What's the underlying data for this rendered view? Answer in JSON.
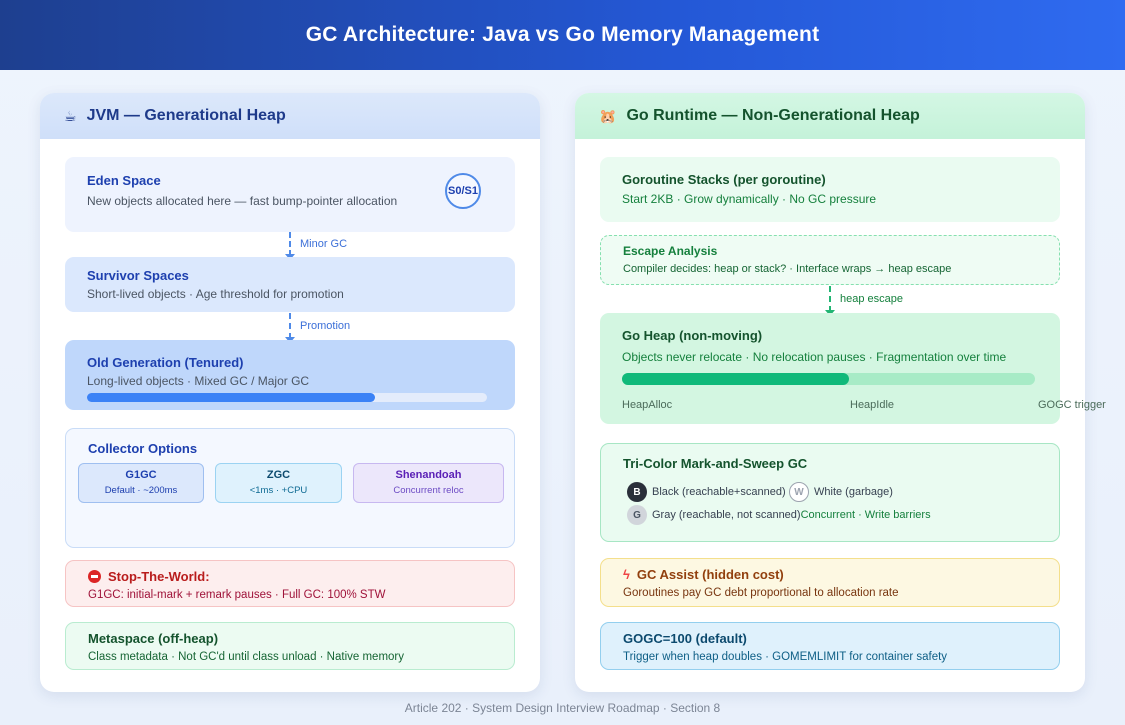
{
  "header": {
    "title": "GC Architecture: Java vs Go Memory Management"
  },
  "jvm": {
    "icon": "☕",
    "title": "JVM — Generational Heap",
    "eden": {
      "title": "Eden Space",
      "desc": "New objects allocated here — fast bump-pointer allocation",
      "badge": "S0/S1"
    },
    "arrow_minor": "Minor GC",
    "survivor": {
      "title": "Survivor Spaces",
      "desc": "Short-lived objects · Age threshold for promotion"
    },
    "arrow_promotion": "Promotion",
    "old_gen": {
      "title": "Old Generation (Tenured)",
      "desc": "Long-lived objects · Mixed GC / Major GC",
      "fill_fraction": 0.72
    },
    "collectors": {
      "title": "Collector Options",
      "items": [
        {
          "name": "G1GC",
          "desc": "Default · ~200ms"
        },
        {
          "name": "ZGC",
          "desc": "<1ms · +CPU"
        },
        {
          "name": "Shenandoah",
          "desc": "Concurrent reloc"
        }
      ]
    },
    "stw": {
      "title": "Stop-The-World:",
      "desc": "G1GC: initial-mark + remark pauses · Full GC: 100% STW"
    },
    "metaspace": {
      "title": "Metaspace (off-heap)",
      "desc": "Class metadata · Not GC'd until class unload · Native memory"
    }
  },
  "go": {
    "icon": "🐹",
    "title": "Go Runtime — Non-Generational Heap",
    "stacks": {
      "title": "Goroutine Stacks (per goroutine)",
      "desc": "Start 2KB · Grow dynamically · No GC pressure"
    },
    "escape": {
      "title": "Escape Analysis",
      "desc": "Compiler decides: heap or stack? · Interface wraps → heap escape"
    },
    "arrow_escape": "heap escape",
    "heap": {
      "title": "Go Heap (non-moving)",
      "desc": "Objects never relocate · No relocation pauses · Fragmentation over time",
      "fill_fraction": 0.55,
      "labels": [
        "HeapAlloc",
        "HeapIdle",
        "GOGC trigger"
      ]
    },
    "tricolor": {
      "title": "Tri-Color Mark-and-Sweep GC",
      "black": {
        "glyph": "B",
        "label": "Black (reachable+scanned)"
      },
      "white": {
        "glyph": "W",
        "label": "White (garbage)"
      },
      "gray": {
        "glyph": "G",
        "label": "Gray (reachable, not scanned)"
      },
      "note": "Concurrent · Write barriers"
    },
    "assist": {
      "title": "GC Assist (hidden cost)",
      "desc": "Goroutines pay GC debt proportional to allocation rate"
    },
    "gogc": {
      "title": "GOGC=100 (default)",
      "desc": "Trigger when heap doubles · GOMEMLIMIT for container safety"
    }
  },
  "footer": "Article 202 · System Design Interview Roadmap · Section 8"
}
